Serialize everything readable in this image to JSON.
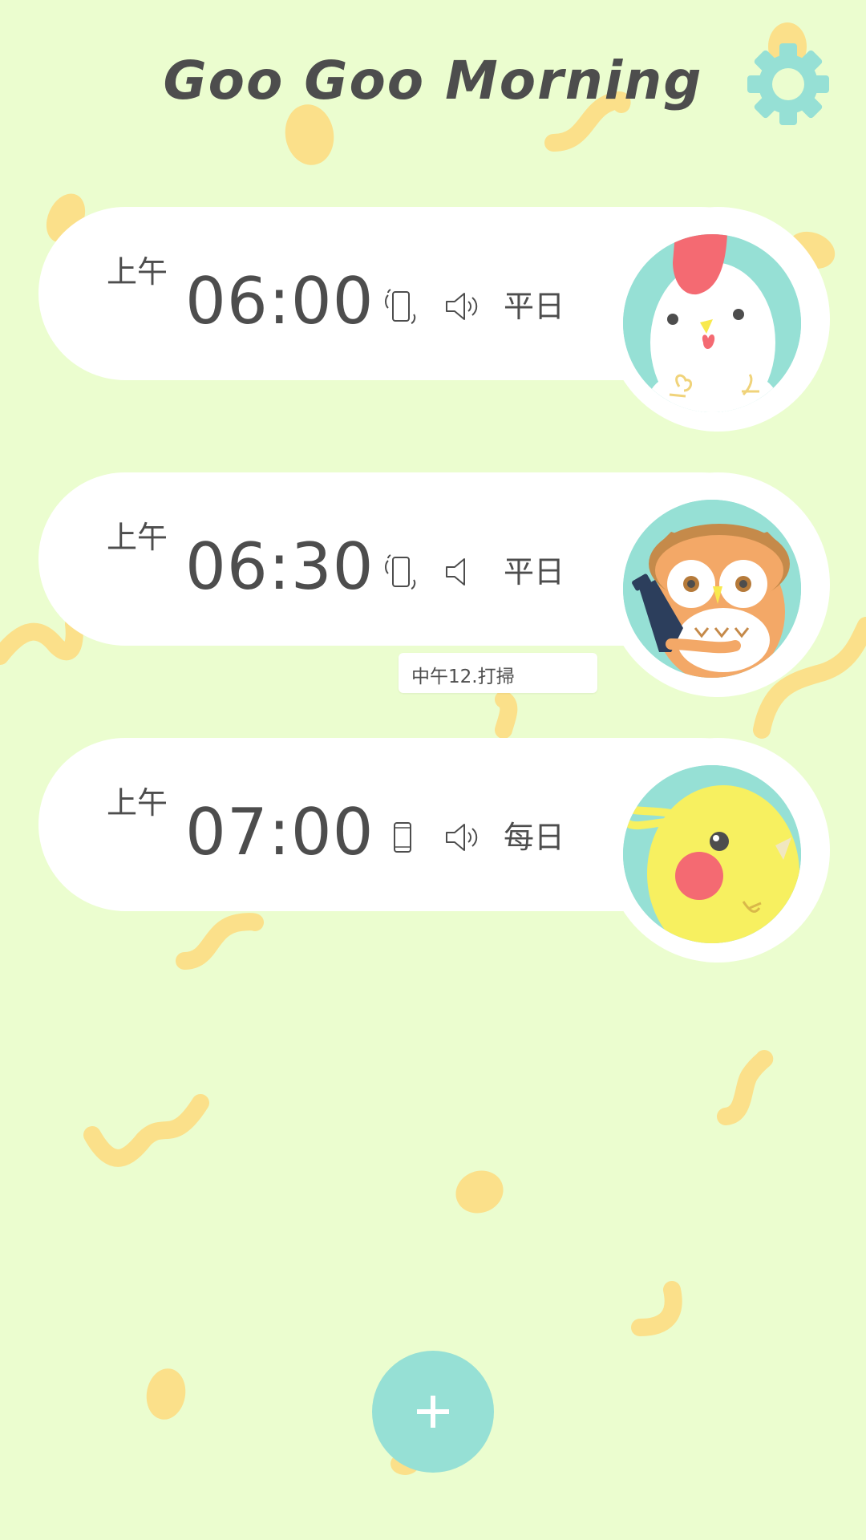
{
  "app": {
    "title": "Goo Goo Morning"
  },
  "colors": {
    "background": "#ebfdcf",
    "accent": "#96e0d5",
    "doodle": "#fbe08a",
    "text": "#4d4d4d"
  },
  "alarms": [
    {
      "ampm": "上午",
      "time": "06:00",
      "vibrate": true,
      "sound": true,
      "repeat": "平日",
      "character": "rooster-icon"
    },
    {
      "ampm": "上午",
      "time": "06:30",
      "vibrate": true,
      "sound": false,
      "repeat": "平日",
      "character": "owl-icon",
      "memo": "中午12.打掃"
    },
    {
      "ampm": "上午",
      "time": "07:00",
      "vibrate": false,
      "sound": true,
      "repeat": "每日",
      "character": "chick-icon"
    }
  ],
  "actions": {
    "settings_icon": "gear-icon",
    "add_icon": "plus-icon"
  }
}
